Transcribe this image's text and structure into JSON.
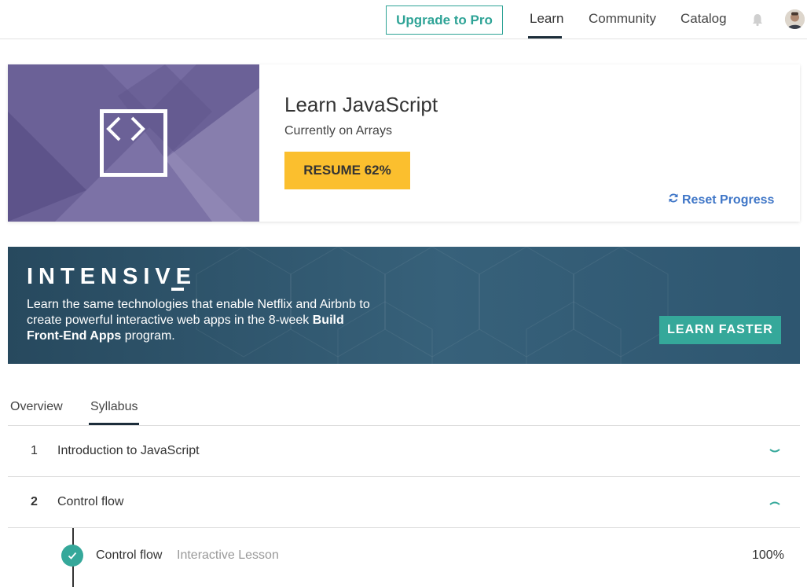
{
  "nav": {
    "upgrade_label": "Upgrade to Pro",
    "links": [
      "Learn",
      "Community",
      "Catalog"
    ],
    "active": "Learn"
  },
  "course": {
    "title": "Learn JavaScript",
    "current": "Currently on Arrays",
    "resume_label": "RESUME 62%",
    "progress_percent": 62,
    "reset_label": "Reset Progress"
  },
  "banner": {
    "heading": "INTENSIVE",
    "text_plain_1": "Learn the same technologies that enable Netflix and Airbnb to create powerful interactive web apps in the 8-week ",
    "text_bold": "Build Front-End Apps",
    "text_plain_2": " program.",
    "cta_label": "LEARN FASTER"
  },
  "tabs": [
    "Overview",
    "Syllabus"
  ],
  "active_tab": "Syllabus",
  "syllabus": [
    {
      "num": "1",
      "title": "Introduction to JavaScript",
      "expanded": false
    },
    {
      "num": "2",
      "title": "Control flow",
      "expanded": true
    }
  ],
  "lessons": [
    {
      "title": "Control flow",
      "type": "Interactive Lesson",
      "progress": "100%",
      "completed": true
    }
  ],
  "colors": {
    "accent": "#2ea396",
    "resume": "#fbbf2e",
    "link": "#3f76c7",
    "banner": "#37617a",
    "course_image": "#6b6197"
  }
}
